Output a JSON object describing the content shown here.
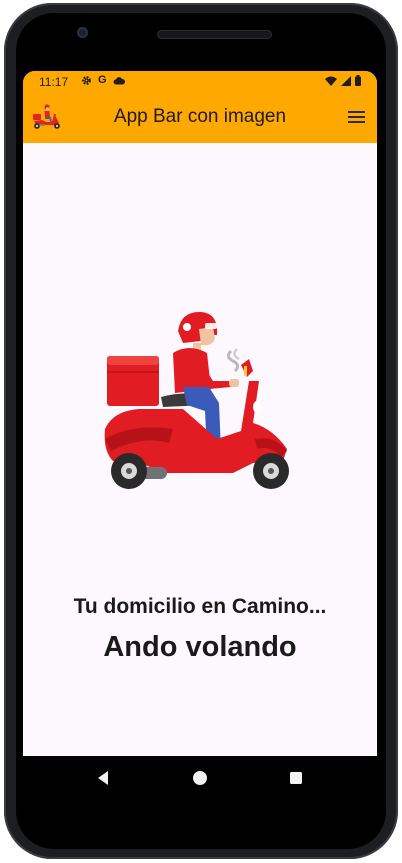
{
  "status_bar": {
    "time": "11:17",
    "left_icons": [
      "gear-icon",
      "google-g-icon",
      "cloud-icon"
    ],
    "right_icons": [
      "wifi-icon",
      "signal-icon",
      "battery-icon"
    ],
    "g_glyph": "G"
  },
  "app_bar": {
    "title": "App Bar con imagen",
    "background_color": "#ffa800",
    "logo_icon": "delivery-scooter-icon",
    "menu_icon": "hamburger-menu-icon"
  },
  "main": {
    "illustration": "delivery-rider-scooter-illustration",
    "subtitle": "Tu domicilio en Camino...",
    "headline": "Ando volando",
    "background_color": "#fdf8fd"
  },
  "nav_bar": {
    "buttons": [
      "back-icon",
      "home-icon",
      "recents-icon"
    ]
  }
}
